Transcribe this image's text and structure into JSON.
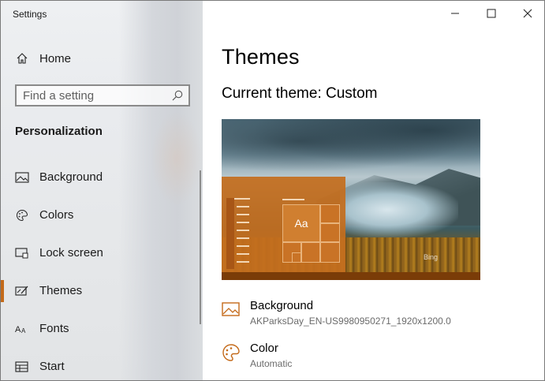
{
  "window": {
    "title": "Settings"
  },
  "sidebar": {
    "home_label": "Home",
    "search_placeholder": "Find a setting",
    "section_heading": "Personalization",
    "items": [
      {
        "label": "Background",
        "icon": "picture-icon"
      },
      {
        "label": "Colors",
        "icon": "palette-icon"
      },
      {
        "label": "Lock screen",
        "icon": "lock-screen-icon"
      },
      {
        "label": "Themes",
        "icon": "themes-icon",
        "active": true
      },
      {
        "label": "Fonts",
        "icon": "fonts-icon"
      },
      {
        "label": "Start",
        "icon": "start-icon"
      }
    ]
  },
  "main": {
    "title": "Themes",
    "current_theme": "Current theme: Custom",
    "preview": {
      "tile_text": "Aa",
      "watermark": "Bing"
    },
    "settings": [
      {
        "title": "Background",
        "value": "AKParksDay_EN-US9980950271_1920x1200.0",
        "icon": "picture-icon"
      },
      {
        "title": "Color",
        "value": "Automatic",
        "icon": "palette-icon"
      }
    ]
  },
  "colors": {
    "accent": "#c46a1a",
    "tile_panel": "#c46e1e"
  }
}
